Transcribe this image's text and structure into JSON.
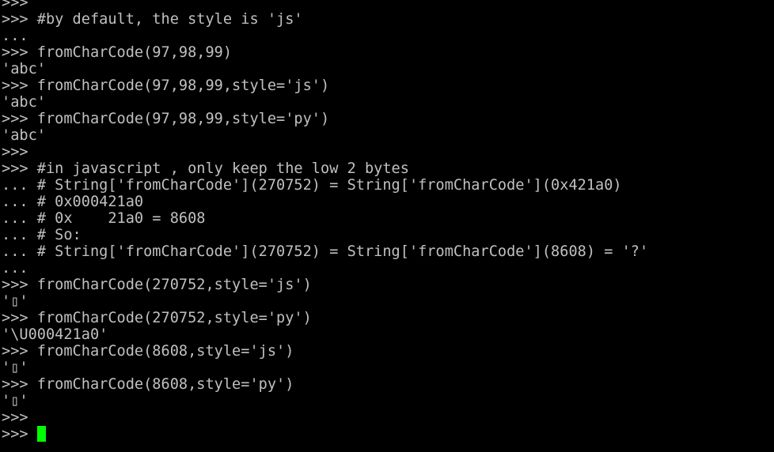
{
  "terminal": {
    "colors": {
      "background": "#000000",
      "text": "#c0c0c0",
      "cursor": "#00ff00"
    },
    "lines": [
      ">>>",
      ">>> #by default, the style is 'js'",
      "...",
      ">>> fromCharCode(97,98,99)",
      "'abc'",
      ">>> fromCharCode(97,98,99,style='js')",
      "'abc'",
      ">>> fromCharCode(97,98,99,style='py')",
      "'abc'",
      ">>>",
      ">>> #in javascript , only keep the low 2 bytes",
      "... # String['fromCharCode'](270752) = String['fromCharCode'](0x421a0)",
      "... # 0x000421a0",
      "... # 0x    21a0 = 8608",
      "... # So:",
      "... # String['fromCharCode'](270752) = String['fromCharCode'](8608) = '?'",
      "...",
      ">>> fromCharCode(270752,style='js')",
      "'▯'",
      ">>> fromCharCode(270752,style='py')",
      "'\\U000421a0'",
      ">>> fromCharCode(8608,style='js')",
      "'▯'",
      ">>> fromCharCode(8608,style='py')",
      "'▯'",
      ">>>"
    ],
    "prompt": ">>> "
  }
}
